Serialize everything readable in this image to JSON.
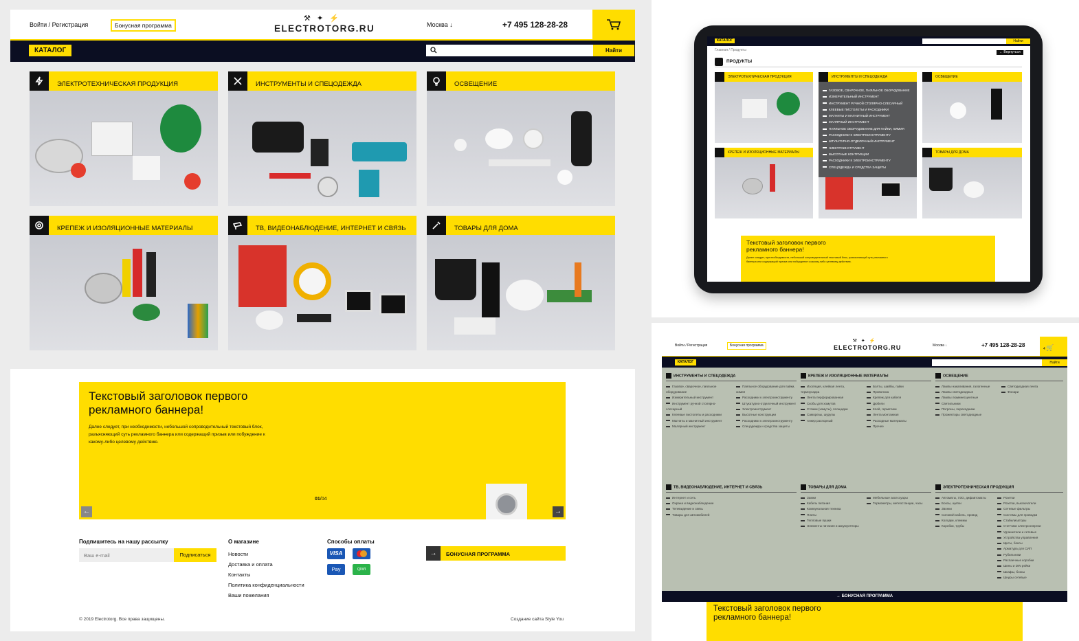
{
  "desktop": {
    "header": {
      "login": "Войти / Регистрация",
      "bonus": "Бонусная программа",
      "logo": "ELECTROTORG.RU",
      "city": "Москва",
      "city_arrow": "↓",
      "phone": "+7 495 128-28-28"
    },
    "catalog_label": "КАТАЛОГ",
    "search_button": "Найти",
    "categories": [
      {
        "label": "ЭЛЕКТРОТЕХНИЧЕСКАЯ ПРОДУКЦИЯ",
        "icon": "lightning-icon"
      },
      {
        "label": "ИНСТРУМЕНТЫ И СПЕЦОДЕЖДА",
        "icon": "tools-icon"
      },
      {
        "label": "ОСВЕЩЕНИЕ",
        "icon": "bulb-icon"
      },
      {
        "label": "КРЕПЕЖ И ИЗОЛЯЦИОННЫЕ МАТЕРИАЛЫ",
        "icon": "tape-icon"
      },
      {
        "label": "ТВ, ВИДЕОНАБЛЮДЕНИЕ, ИНТЕРНЕТ И СВЯЗЬ",
        "icon": "camera-icon"
      },
      {
        "label": "ТОВАРЫ ДЛЯ ДОМА",
        "icon": "wrench-icon"
      }
    ],
    "banner": {
      "title_line1": "Текстовый заголовок первого",
      "title_line2": "рекламного баннера!",
      "text_line1": "Далее следует, при необходимости, небольшой сопроводительный текстовый блок,",
      "text_line2": "разъясняющий суть рекламного баннера или содержащий призыв или побуждение к",
      "text_line3": "какому-либо целевому действию.",
      "page_current": "01",
      "page_total": "/04"
    },
    "footer": {
      "subscribe_title": "Подпишитесь на нашу рассылку",
      "email_placeholder": "Ваш e-mail",
      "subscribe_button": "Подписаться",
      "about_title": "О магазине",
      "about_links": [
        "Новости",
        "Доставка и оплата",
        "Контакты",
        "Политика конфиденциальности",
        "Ваши пожелания"
      ],
      "payments_title": "Способы оплаты",
      "payments": [
        "VISA",
        "MC",
        "Pay",
        "QIWI"
      ],
      "bonus_label": "БОНУСНАЯ ПРОГРАММА",
      "copyright": "© 2019 Electrotorg. Все права защищены.",
      "credits": "Создание сайта Style You"
    }
  },
  "tablet": {
    "catalog_label": "КАТАЛОГ",
    "search_button": "Найти",
    "breadcrumb": "Главная / Продукты",
    "back": "← Вернуться",
    "page_title": "ПРОДУКТЫ",
    "categories": [
      "ЭЛЕКТРОТЕХНИЧЕСКАЯ ПРОДУКЦИЯ",
      "ИНСТРУМЕНТЫ И СПЕЦОДЕЖДА",
      "ОСВЕЩЕНИЕ",
      "КРЕПЕЖ И ИЗОЛЯЦИОННЫЕ МАТЕРИАЛЫ",
      "",
      "ТОВАРЫ ДЛЯ ДОМА"
    ],
    "dropdown": [
      "ГАЗОВОЕ, СВАРОЧНОЕ, ПАЯЛЬНОЕ ОБОРУДОВАНИЕ",
      "ИЗМЕРИТЕЛЬНЫЙ ИНСТРУМЕНТ",
      "ИНСТРУМЕНТ РУЧНОЙ СТОЛЯРНО-СЛЕСАРНЫЙ",
      "КЛЕЕВЫЕ ПИСТОЛЕТЫ И РАСХОДНИКИ",
      "МАГНИТЫ И МАГНИТНЫЙ ИНСТРУМЕНТ",
      "МАЛЯРНЫЙ ИНСТРУМЕНТ",
      "ПАЯЛЬНОЕ ОБОРУДОВАНИЕ ДЛЯ ПАЙКИ, ХИМИЯ",
      "РАСХОДНИКИ К ЭЛЕКТРОИНСТРУМЕНТУ",
      "ШТУКАТУРНО-ОТДЕЛОЧНЫЙ ИНСТРУМЕНТ",
      "ЭЛЕКТРОИНСТРУМЕНТ",
      "ВЫСОТНЫЕ КОНТРУКЦИИ",
      "РАСХОДНИКИ К ЭЛЕКТРОИНСТРУМЕНТУ",
      "СПЕЦОДЕЖДА И СРЕДСТВА ЗАЩИТЫ"
    ],
    "banner_title_line1": "Текстовый заголовок первого",
    "banner_title_line2": "рекламного баннера!",
    "banner_text": "Далее следует, при необходимости, небольшой сопроводительный текстовый блок, разъясняющий суть рекламного баннера или содержащий призыв или побуждение к какому-либо целевому действию."
  },
  "mega": {
    "header": {
      "login": "Войти / Регистрация",
      "bonus": "Бонусная программа",
      "logo": "ELECTROTORG.RU",
      "city": "Москва ↓",
      "phone": "+7 495 128-28-28",
      "cart_count": "4"
    },
    "catalog_label": "КАТАЛОГ",
    "search_button": "Найти",
    "sections": [
      {
        "title": "ИНСТРУМЕНТЫ И СПЕЦОДЕЖДА",
        "col1": [
          "Газовое, сварочное, паяльное оборудование",
          "Измерительный инструмент",
          "Инструмент ручной столярно-слесарный",
          "Клеевые пистолеты и расходники",
          "Магниты и магнитный инструмент",
          "Малярный инструмент"
        ],
        "col2": [
          "Паяльное оборудование для пайки, химия",
          "Расходники к электроинструменту",
          "Штукатурно-отделочный инструмент",
          "Электроинструмент",
          "Высотные конструкции",
          "Расходники к электроинструменту",
          "Спецодежда и средства защиты"
        ]
      },
      {
        "title": "КРЕПЕЖ И ИЗОЛЯЦИОННЫЕ МАТЕРИАЛЫ",
        "col1": [
          "Изоляция, клейкая лента, термоусадка",
          "Лента перфорированная",
          "Скобы для хомутов",
          "Стяжки (хомуты), площадки",
          "Саморезы, шурупы",
          "Анкер распорный"
        ],
        "col2": [
          "Болты, шайбы, гайки",
          "Проволока",
          "Крепеж для кабеля",
          "Дюбели",
          "Клей, герметики",
          "Лента монтажная",
          "Расходные материалы",
          "Прочее"
        ]
      },
      {
        "title": "ОСВЕЩЕНИЕ",
        "col1": [
          "Лампы накаливания, галогенные",
          "Лампы светодиодные",
          "Лампы люминесцентные",
          "Светильники",
          "Патроны, переходники",
          "Прожекторы светодиодные"
        ],
        "col2": [
          "Светодиодная лента",
          "Фонари"
        ]
      },
      {
        "title": "ТВ, ВИДЕОНАБЛЮДЕНИЕ, ИНТЕРНЕТ И СВЯЗЬ",
        "col1": [
          "Интернет и сеть",
          "Охрана и видеонаблюдение",
          "Телевидение и связь",
          "Товары для автомобилей"
        ],
        "col2": []
      },
      {
        "title": "ТОВАРЫ ДЛЯ ДОМА",
        "col1": [
          "Замки",
          "Кабель питания",
          "Коммунальная техника",
          "Плиты",
          "Тепловые пушки",
          "Элементы питания и аккумуляторы"
        ],
        "col2": [
          "Мебельные аксессуары",
          "Термометры, метеостанции, часы"
        ]
      },
      {
        "title": "ЭЛЕКТРОТЕХНИЧЕСКАЯ ПРОДУКЦИЯ",
        "col1": [
          "Автоматы, УЗО, дифавтоматы",
          "Боксы, щитки",
          "Звонки",
          "Силовой кабель, провод",
          "Колодки, клеммы",
          "Коробки, трубы"
        ],
        "col2": [
          "Розетки",
          "Розетки, выключатели",
          "Сетевые фильтры",
          "Системы для проводки",
          "Стабилизаторы",
          "Счетчики электроэнергии",
          "Удлинители и сетевые",
          "Устройства управления",
          "Щиты, боксы",
          "Арматура для СИП",
          "Рубильники",
          "Распаечные коробки",
          "Шины и DIN рейки",
          "Шкафы, боксы",
          "Шнуры сетевые"
        ]
      }
    ],
    "bonus_bar": "→ БОНУСНАЯ ПРОГРАММА",
    "banner_title_line1": "Текстовый заголовок первого",
    "banner_title_line2": "рекламного баннера!"
  }
}
